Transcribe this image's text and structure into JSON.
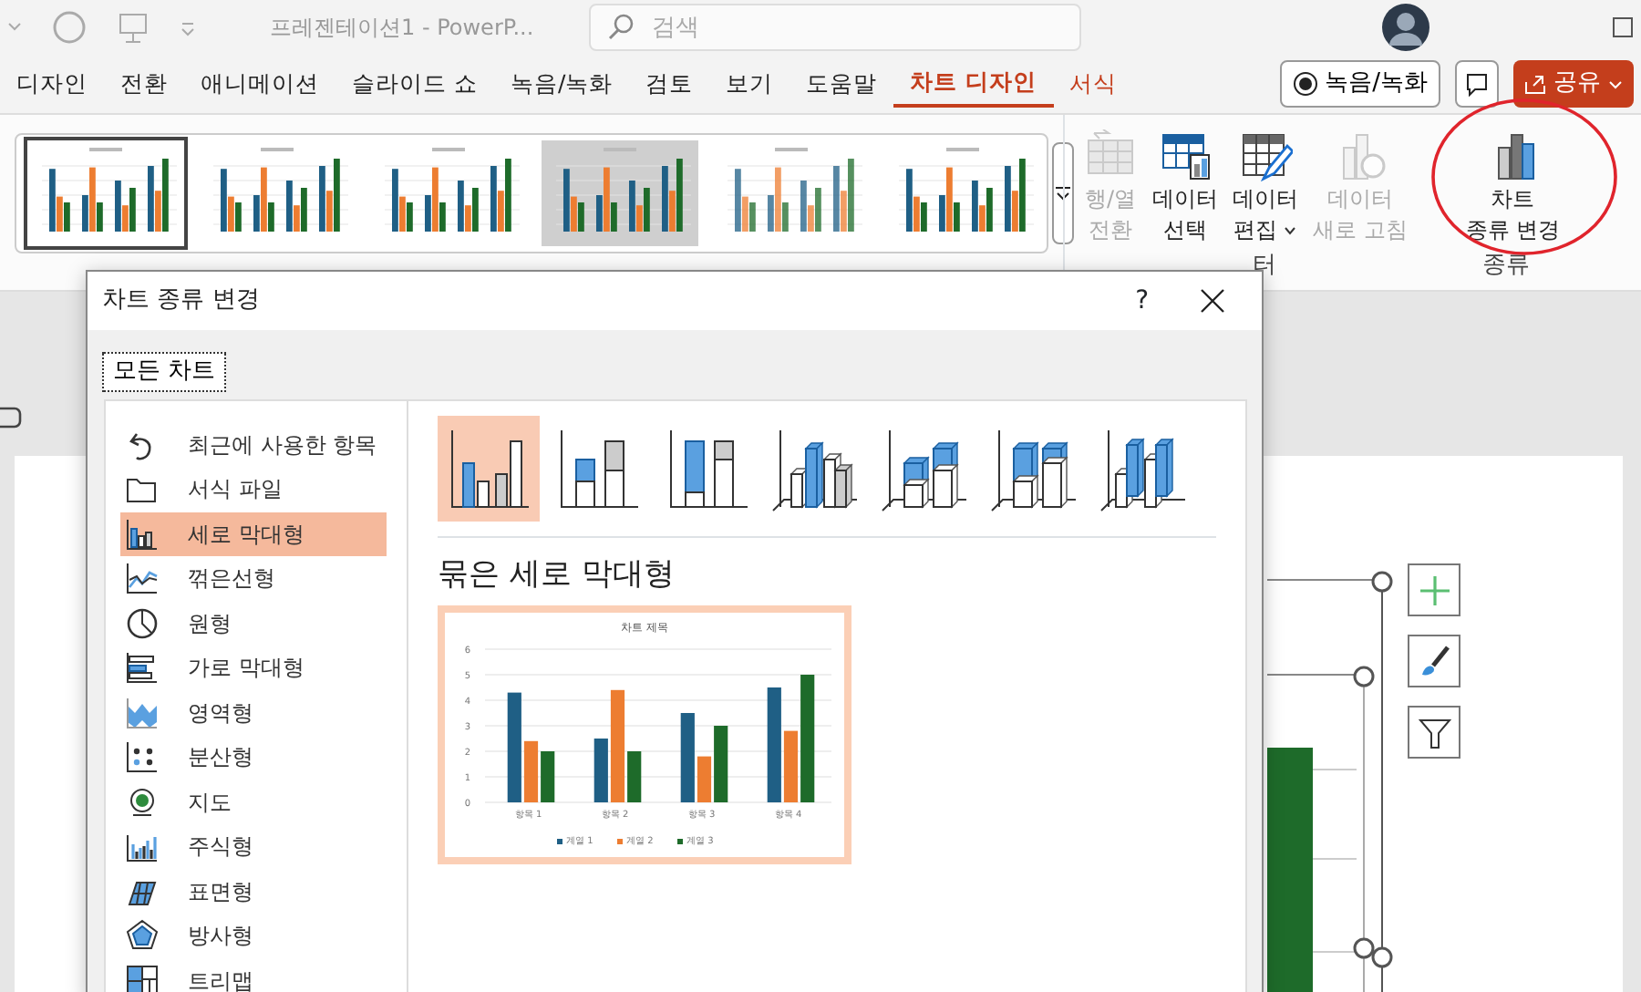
{
  "title_bar": {
    "document_title": "프레젠테이션1  -  PowerP...",
    "search": {
      "placeholder": "검색"
    }
  },
  "ribbon_tabs": [
    {
      "label": "디자인",
      "selected": false,
      "contextual": false
    },
    {
      "label": "전환",
      "selected": false,
      "contextual": false
    },
    {
      "label": "애니메이션",
      "selected": false,
      "contextual": false
    },
    {
      "label": "슬라이드 쇼",
      "selected": false,
      "contextual": false
    },
    {
      "label": "녹음/녹화",
      "selected": false,
      "contextual": false
    },
    {
      "label": "검토",
      "selected": false,
      "contextual": false
    },
    {
      "label": "보기",
      "selected": false,
      "contextual": false
    },
    {
      "label": "도움말",
      "selected": false,
      "contextual": false
    },
    {
      "label": "차트 디자인",
      "selected": true,
      "contextual": true
    },
    {
      "label": "서식",
      "selected": false,
      "contextual": true
    }
  ],
  "record_button": "녹음/녹화",
  "share_button": "공유",
  "chart_styles": [
    {
      "selected": true
    },
    {
      "selected": false
    },
    {
      "selected": false
    },
    {
      "selected": false
    },
    {
      "selected": false
    },
    {
      "selected": false
    }
  ],
  "ribbon_commands": [
    {
      "lines": [
        "행/열",
        "전환"
      ],
      "disabled": true
    },
    {
      "lines": [
        "데이터",
        "선택"
      ],
      "disabled": false
    },
    {
      "lines": [
        "데이터",
        "편집"
      ],
      "disabled": false,
      "dropdown": true
    },
    {
      "lines": [
        "데이터",
        "새로 고침"
      ],
      "disabled": true
    },
    {
      "lines": [
        "차트",
        "종류 변경"
      ],
      "disabled": false,
      "highlighted": true
    }
  ],
  "group_labels": [
    "터",
    "종류"
  ],
  "dialog": {
    "title": "차트 종류 변경",
    "help": "?",
    "tab": "모든 차트",
    "categories": [
      {
        "label": "최근에 사용한 항목",
        "selected": false
      },
      {
        "label": "서식 파일",
        "selected": false
      },
      {
        "label": "세로 막대형",
        "selected": true
      },
      {
        "label": "꺾은선형",
        "selected": false
      },
      {
        "label": "원형",
        "selected": false
      },
      {
        "label": "가로 막대형",
        "selected": false
      },
      {
        "label": "영역형",
        "selected": false
      },
      {
        "label": "분산형",
        "selected": false
      },
      {
        "label": "지도",
        "selected": false
      },
      {
        "label": "주식형",
        "selected": false
      },
      {
        "label": "표면형",
        "selected": false
      },
      {
        "label": "방사형",
        "selected": false
      },
      {
        "label": "트리맵",
        "selected": false
      }
    ],
    "subtypes": [
      {
        "selected": true
      },
      {
        "selected": false
      },
      {
        "selected": false
      },
      {
        "selected": false
      },
      {
        "selected": false
      },
      {
        "selected": false
      },
      {
        "selected": false
      }
    ],
    "subtype_title": "묶은 세로 막대형",
    "preview": {
      "chart_data": {
        "type": "bar",
        "title": "차트 제목",
        "categories": [
          "항목 1",
          "항목 2",
          "항목 3",
          "항목 4"
        ],
        "series": [
          {
            "name": "계열 1",
            "color": "#1f5f85",
            "values": [
              4.3,
              2.5,
              3.5,
              4.5
            ]
          },
          {
            "name": "계열 2",
            "color": "#ed7d31",
            "values": [
              2.4,
              4.4,
              1.8,
              2.8
            ]
          },
          {
            "name": "계열 3",
            "color": "#1e6b2a",
            "values": [
              2,
              2,
              3,
              5
            ]
          }
        ],
        "ylim": [
          0,
          6
        ],
        "yticks": [
          0,
          1,
          2,
          3,
          4,
          5,
          6
        ],
        "grid": true,
        "legend": "bottom"
      }
    }
  }
}
